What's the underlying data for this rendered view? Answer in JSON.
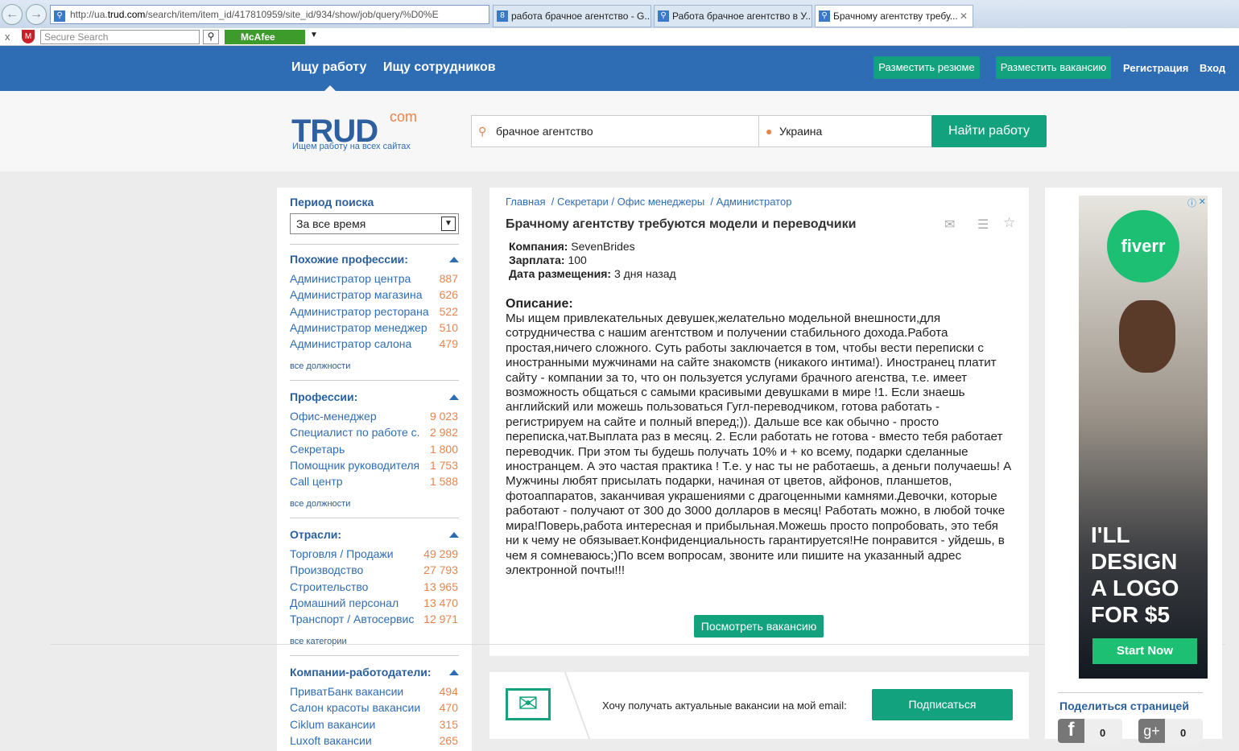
{
  "browser": {
    "url_prefix": "http://ua.",
    "url_domain": "trud.com",
    "url_rest": "/search/item/item_id/417810959/site_id/934/show/job/query/%D0%E",
    "tabs": [
      {
        "label": "работа брачное агентство - G..."
      },
      {
        "label": "Работа брачное агентство в У..."
      },
      {
        "label": "Брачному агентству требу..."
      }
    ],
    "search_placeholder": "Secure Search",
    "mcafee": "McAfee"
  },
  "nav": {
    "find_job": "Ищу работу",
    "find_staff": "Ищу сотрудников",
    "post_resume": "Разместить резюме",
    "post_vacancy": "Разместить вакансию",
    "register": "Регистрация",
    "login": "Вход"
  },
  "header": {
    "logo": "TRUD",
    "logo_suffix": "com",
    "tagline": "Ищем работу на всех сайтах",
    "query": "брачное агентство",
    "location": "Украина",
    "search_button": "Найти работу"
  },
  "sidebar": {
    "period_title": "Период поиска",
    "period_value": "За все время",
    "sections": [
      {
        "title": "Похожие профессии:",
        "items": [
          {
            "label": "Администратор центра",
            "count": "887"
          },
          {
            "label": "Администратор магазина",
            "count": "626"
          },
          {
            "label": "Администратор ресторана",
            "count": "522"
          },
          {
            "label": "Администратор менеджер",
            "count": "510"
          },
          {
            "label": "Администратор салона",
            "count": "479"
          }
        ],
        "all": "все должности"
      },
      {
        "title": "Профессии:",
        "items": [
          {
            "label": "Офис-менеджер",
            "count": "9 023"
          },
          {
            "label": "Специалист по работе с.",
            "count": "2 982"
          },
          {
            "label": "Секретарь",
            "count": "1 800"
          },
          {
            "label": "Помощник руководителя",
            "count": "1 753"
          },
          {
            "label": "Call центр",
            "count": "1 588"
          }
        ],
        "all": "все должности"
      },
      {
        "title": "Отрасли:",
        "items": [
          {
            "label": "Торговля / Продажи",
            "count": "49 299"
          },
          {
            "label": "Производство",
            "count": "27 793"
          },
          {
            "label": "Строительство",
            "count": "13 965"
          },
          {
            "label": "Домашний персонал",
            "count": "13 470"
          },
          {
            "label": "Транспорт / Автосервис",
            "count": "12 971"
          }
        ],
        "all": "все категории"
      },
      {
        "title": "Компании-работодатели:",
        "items": [
          {
            "label": "ПриватБанк вакансии",
            "count": "494"
          },
          {
            "label": "Салон красоты вакансии",
            "count": "470"
          },
          {
            "label": "Ciklum вакансии",
            "count": "315"
          },
          {
            "label": "Luxoft вакансии",
            "count": "265"
          }
        ]
      }
    ]
  },
  "job": {
    "breadcrumbs": [
      "Главная",
      "Секретари / Офис менеджеры",
      "Администратор"
    ],
    "title": "Брачному агентству требуются модели и переводчики",
    "company_label": "Компания:",
    "company": "SevenBrides",
    "salary_label": "Зарплата:",
    "salary": "100",
    "date_label": "Дата размещения:",
    "date": "3 дня назад",
    "desc_title": "Описание:",
    "description": "Мы ищем привлекательных девушек,желательно модельной внешности,для сотрудничества с нашим агентством и получении стабильного дохода.Работа простая,ничего сложного. Суть работы заключается в том, чтобы вести переписки с иностранными мужчинами на сайте знакомств (никакого интима!). Иностранец платит сайту - компании за то, что он пользуется услугами брачного агенства, т.е. имеет возможность общаться с самыми красивыми девушками в мире !1. Если знаешь английский или можешь пользоваться Гугл-переводчиком, готова работать - регистрируем на сайте и полный вперед;)). Дальше все как обычно - просто переписка,чат.Выплата раз в месяц. 2. Если работать не готова - вместо тебя работает переводчик. При этом ты будешь получать 10% и + ко всему, подарки сделанные иностранцем. А это частая практика ! Т.е. у нас ты не работаешь, а деньги получаешь! А Мужчины любят присылать подарки, начиная от цветов, айфонов, планшетов, фотоаппаратов, заканчивая украшениями с драгоценными камнями.Девочки, которые работают - получают от 300 до 3000 долларов в месяц! Работать можно, в любой точке мира!Поверь,работа интересная и прибыльная.Можешь просто попробовать, это тебя ни к чему не обязывает.Конфиденциальность гарантируется!Не понравится - уйдешь, в чем я сомневаюсь;)По всем вопросам, звоните или пишите на указанный адрес электронной почты!!!",
    "view_button": "Посмотреть вакансию"
  },
  "subscribe": {
    "text": "Хочу получать актуальные вакансии на мой email:",
    "button": "Подписаться"
  },
  "ad": {
    "brand": "fiverr",
    "headline": "I'LL DESIGN A LOGO FOR $5",
    "cta": "Start Now"
  },
  "share": {
    "title": "Поделиться страницей",
    "facebook_count": "0",
    "gplus_count": "0"
  },
  "colors": {
    "nav": "#2e6db4",
    "accent": "#13a27e",
    "count": "#e8844a"
  }
}
